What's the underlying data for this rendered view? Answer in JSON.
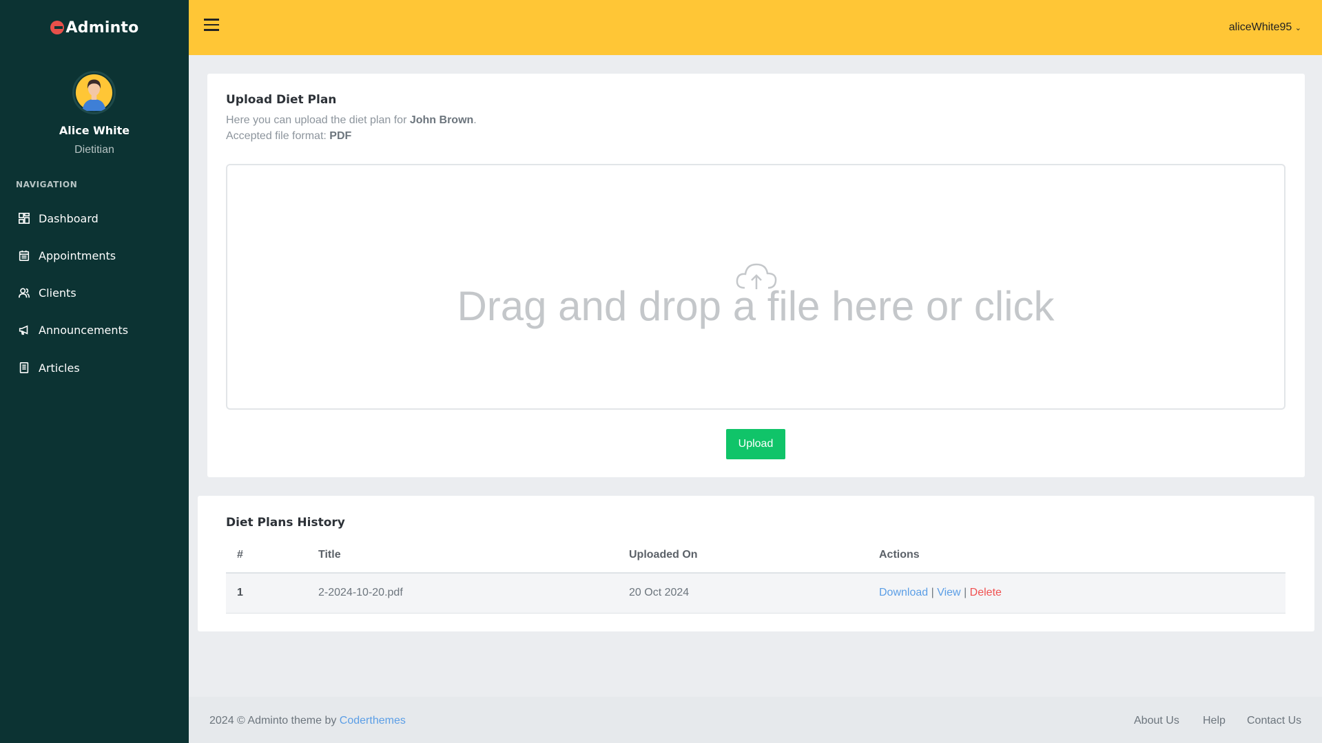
{
  "app": {
    "logo_text": "Adminto"
  },
  "user": {
    "name": "Alice White",
    "role": "Dietitian",
    "username": "aliceWhite95"
  },
  "sidebar": {
    "section_title": "NAVIGATION",
    "items": [
      {
        "label": "Dashboard",
        "icon": "dashboard-icon"
      },
      {
        "label": "Appointments",
        "icon": "calendar-icon"
      },
      {
        "label": "Clients",
        "icon": "users-icon"
      },
      {
        "label": "Announcements",
        "icon": "megaphone-icon"
      },
      {
        "label": "Articles",
        "icon": "document-icon"
      }
    ]
  },
  "upload": {
    "title": "Upload Diet Plan",
    "desc_prefix": "Here you can upload the diet plan for ",
    "client_name": "John Brown",
    "desc_suffix": ".",
    "format_prefix": "Accepted file format: ",
    "format": "PDF",
    "dropzone_text": "Drag and drop a file here or click",
    "button_label": "Upload"
  },
  "history": {
    "title": "Diet Plans History",
    "columns": [
      "#",
      "Title",
      "Uploaded On",
      "Actions"
    ],
    "rows": [
      {
        "index": "1",
        "title": "2-2024-10-20.pdf",
        "uploaded_on": "20 Oct 2024",
        "actions": {
          "download": "Download",
          "view": "View",
          "delete": "Delete",
          "separator": "|"
        }
      }
    ]
  },
  "footer": {
    "copyright": "2024 © Adminto theme by ",
    "author_link": "Coderthemes",
    "links": [
      "About Us",
      "Help",
      "Contact Us"
    ]
  },
  "colors": {
    "sidebar": "#0c3333",
    "topbar": "#ffc636",
    "upload_button": "#10c469",
    "link": "#5b9ee6",
    "danger": "#f05050"
  }
}
